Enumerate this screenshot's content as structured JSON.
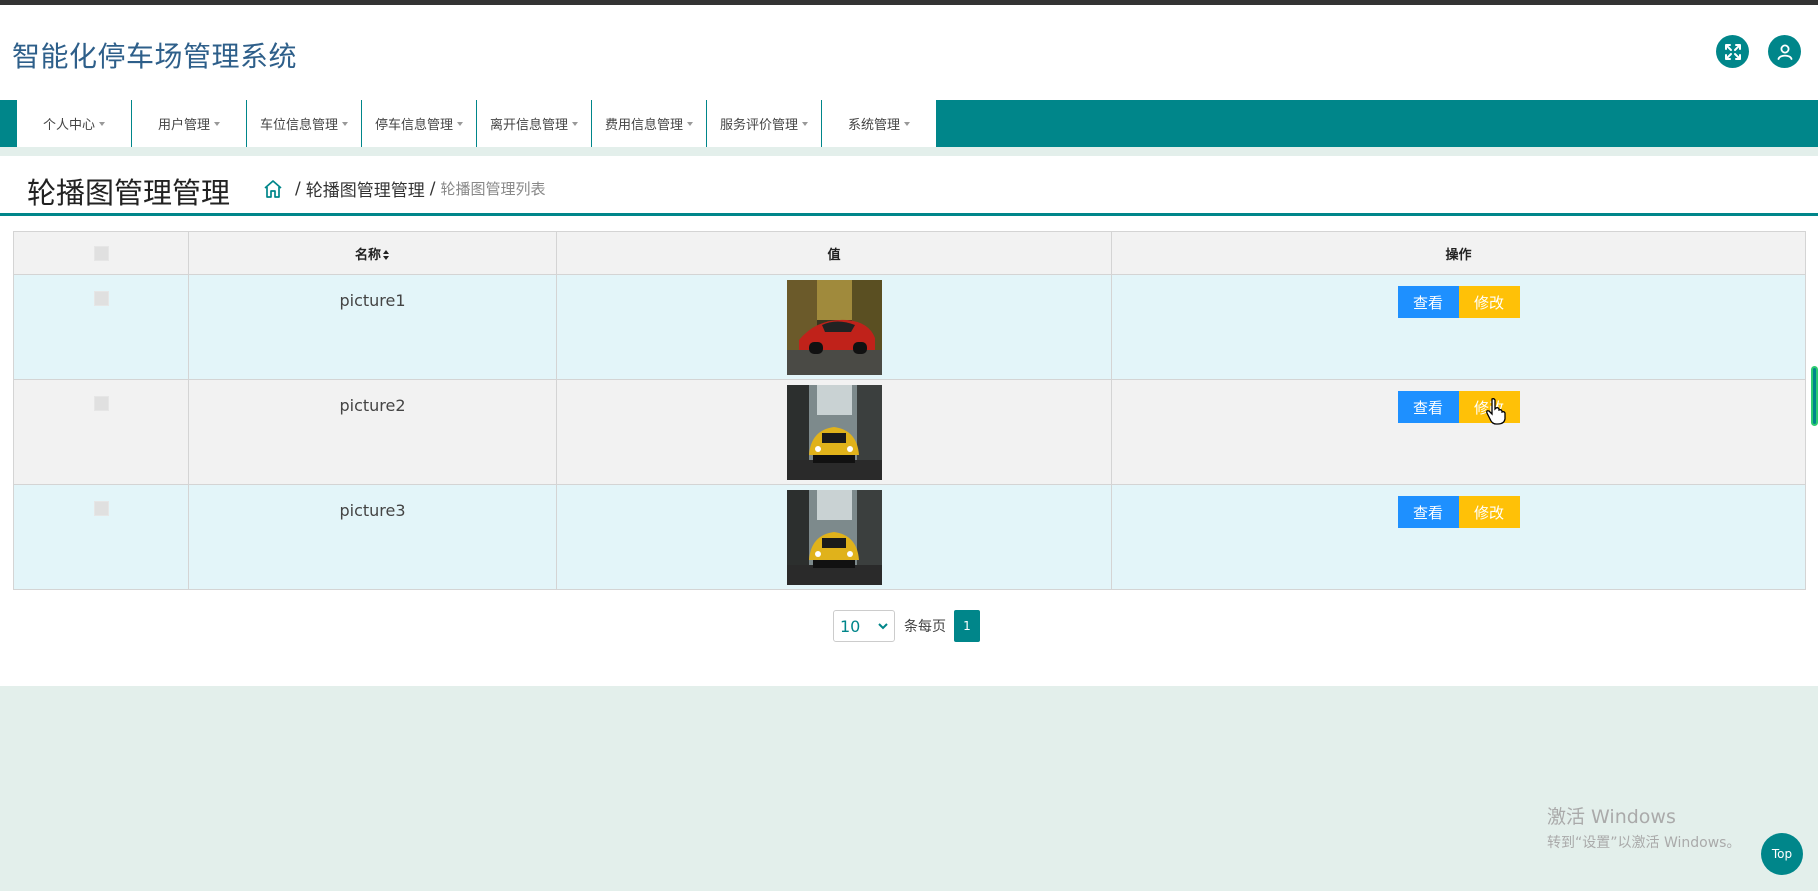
{
  "app": {
    "title": "智能化停车场管理系统"
  },
  "header": {
    "fullscreen_icon": "expand-icon",
    "user_icon": "user-icon"
  },
  "nav": {
    "items": [
      {
        "label": "个人中心"
      },
      {
        "label": "用户管理"
      },
      {
        "label": "车位信息管理"
      },
      {
        "label": "停车信息管理"
      },
      {
        "label": "离开信息管理"
      },
      {
        "label": "费用信息管理"
      },
      {
        "label": "服务评价管理"
      },
      {
        "label": "系统管理"
      }
    ]
  },
  "page": {
    "title": "轮播图管理管理",
    "breadcrumb": {
      "home_icon": "home-icon",
      "section": "轮播图管理管理",
      "current": "轮播图管理列表",
      "sep": "/"
    }
  },
  "table": {
    "headers": {
      "name": "名称",
      "value": "值",
      "actions": "操作"
    },
    "rows": [
      {
        "name": "picture1",
        "image": "red-car-thumbnail",
        "view": "查看",
        "edit": "修改"
      },
      {
        "name": "picture2",
        "image": "yellow-car-thumbnail",
        "view": "查看",
        "edit": "修改"
      },
      {
        "name": "picture3",
        "image": "yellow-car-thumbnail",
        "view": "查看",
        "edit": "修改"
      }
    ]
  },
  "pager": {
    "page_size": "10",
    "per_page_label": "条每页",
    "current_page": "1"
  },
  "watermark": {
    "line1": "激活 Windows",
    "line2": "转到“设置”以激活 Windows。"
  },
  "top_button": {
    "label": "Top"
  },
  "colors": {
    "primary": "#00868a",
    "view_button": "#1e90ff",
    "edit_button": "#ffc107",
    "title_blue": "#2e5f8a"
  }
}
